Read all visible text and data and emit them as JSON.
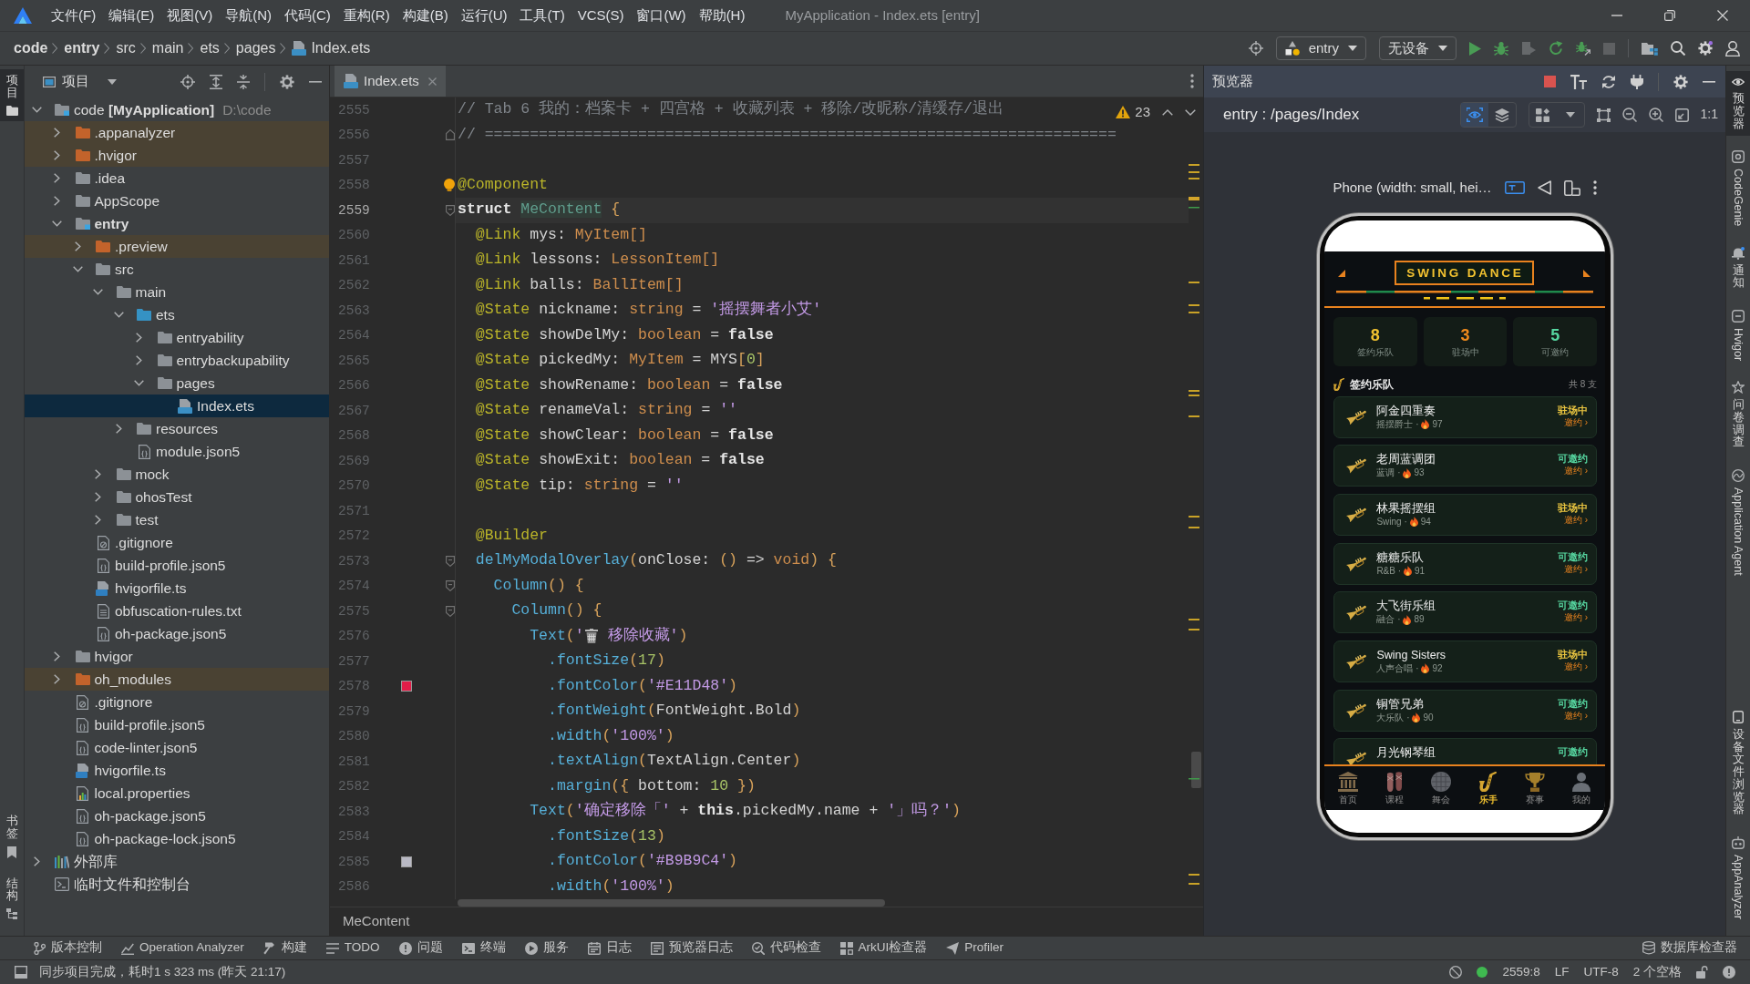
{
  "window": {
    "title": "MyApplication - Index.ets [entry]"
  },
  "menu": [
    "文件(F)",
    "编辑(E)",
    "视图(V)",
    "导航(N)",
    "代码(C)",
    "重构(R)",
    "构建(B)",
    "运行(U)",
    "工具(T)",
    "VCS(S)",
    "窗口(W)",
    "帮助(H)"
  ],
  "breadcrumb": [
    {
      "label": "code",
      "kind": "module"
    },
    {
      "label": "entry",
      "kind": "module"
    },
    {
      "label": "src",
      "kind": "folder"
    },
    {
      "label": "main",
      "kind": "folder"
    },
    {
      "label": "ets",
      "kind": "folder"
    },
    {
      "label": "pages",
      "kind": "folder"
    },
    {
      "label": "Index.ets",
      "kind": "ets-file"
    }
  ],
  "run_toolbar": {
    "module": "entry",
    "device": "无设备"
  },
  "left_strip": {
    "top": [
      {
        "label": "项目",
        "kind": "project",
        "selected": true
      }
    ],
    "bottom": [
      {
        "label": "书签",
        "kind": "bookmarks",
        "selected": false
      },
      {
        "label": "结构",
        "kind": "structure",
        "selected": false
      }
    ]
  },
  "project": {
    "title": "项目",
    "tree": [
      {
        "label": "code **[MyApplication]**",
        "path": "D:\\code",
        "kind": "project",
        "expanded": true,
        "selected": false,
        "children": [
          {
            "label": ".appanalyzer",
            "kind": "excluded",
            "expanded": false,
            "selected": false
          },
          {
            "label": ".hvigor",
            "kind": "excluded",
            "expanded": false,
            "selected": false
          },
          {
            "label": ".idea",
            "kind": "folder",
            "expanded": false,
            "selected": false
          },
          {
            "label": "AppScope",
            "kind": "folder",
            "expanded": false,
            "selected": false
          },
          {
            "label": "entry",
            "kind": "module",
            "expanded": true,
            "selected": false,
            "children": [
              {
                "label": ".preview",
                "kind": "excluded",
                "expanded": false,
                "selected": false
              },
              {
                "label": "src",
                "kind": "folder",
                "expanded": true,
                "selected": false,
                "children": [
                  {
                    "label": "main",
                    "kind": "folder",
                    "expanded": true,
                    "selected": false,
                    "children": [
                      {
                        "label": "ets",
                        "kind": "source",
                        "expanded": true,
                        "selected": false,
                        "children": [
                          {
                            "label": "entryability",
                            "kind": "folder",
                            "expanded": false,
                            "selected": false
                          },
                          {
                            "label": "entrybackupability",
                            "kind": "folder",
                            "expanded": false,
                            "selected": false
                          },
                          {
                            "label": "pages",
                            "kind": "folder",
                            "expanded": true,
                            "selected": false,
                            "children": [
                              {
                                "label": "Index.ets",
                                "kind": "ets-file",
                                "selected": true
                              }
                            ]
                          }
                        ]
                      },
                      {
                        "label": "resources",
                        "kind": "folder",
                        "expanded": false,
                        "selected": false
                      },
                      {
                        "label": "module.json5",
                        "kind": "json-file",
                        "selected": false
                      }
                    ]
                  },
                  {
                    "label": "mock",
                    "kind": "folder",
                    "expanded": false,
                    "selected": false
                  },
                  {
                    "label": "ohosTest",
                    "kind": "folder",
                    "expanded": false,
                    "selected": false
                  },
                  {
                    "label": "test",
                    "kind": "folder",
                    "expanded": false,
                    "selected": false
                  }
                ]
              },
              {
                "label": ".gitignore",
                "kind": "ignore-file",
                "selected": false
              },
              {
                "label": "build-profile.json5",
                "kind": "json-file",
                "selected": false
              },
              {
                "label": "hvigorfile.ts",
                "kind": "ts-file",
                "selected": false
              },
              {
                "label": "obfuscation-rules.txt",
                "kind": "text-file",
                "selected": false
              },
              {
                "label": "oh-package.json5",
                "kind": "json-file",
                "selected": false
              }
            ]
          },
          {
            "label": "hvigor",
            "kind": "folder",
            "expanded": false,
            "selected": false
          },
          {
            "label": "oh_modules",
            "kind": "excluded",
            "expanded": false,
            "selected": false
          },
          {
            "label": ".gitignore",
            "kind": "ignore-file",
            "selected": false
          },
          {
            "label": "build-profile.json5",
            "kind": "json-file",
            "selected": false
          },
          {
            "label": "code-linter.json5",
            "kind": "json-file",
            "selected": false
          },
          {
            "label": "hvigorfile.ts",
            "kind": "ts-file",
            "selected": false
          },
          {
            "label": "local.properties",
            "kind": "properties-file",
            "selected": false
          },
          {
            "label": "oh-package.json5",
            "kind": "json-file",
            "selected": false
          },
          {
            "label": "oh-package-lock.json5",
            "kind": "json-file",
            "selected": false
          }
        ]
      },
      {
        "label": "外部库",
        "kind": "library",
        "expanded": false,
        "selected": false
      },
      {
        "label": "临时文件和控制台",
        "kind": "scratch",
        "selected": false
      }
    ]
  },
  "editor": {
    "tabs": [
      {
        "label": "Index.ets",
        "selected": true
      }
    ],
    "warnings": "23",
    "structure_path": "MeContent",
    "lines": [
      {
        "number": "2555",
        "current": false,
        "tokens": [
          {
            "kind": "comment",
            "text": "// Tab 6 我的：档案卡 + 四宫格 + 收藏列表 + 移除/改昵称/清缓存/退出"
          }
        ]
      },
      {
        "number": "2556",
        "current": false,
        "fold_end": true,
        "tokens": [
          {
            "kind": "comment",
            "text": "// ======================================================================"
          }
        ]
      },
      {
        "number": "2557",
        "current": false
      },
      {
        "number": "2558",
        "current": false,
        "bulb": true,
        "tokens": [
          {
            "kind": "decorator",
            "text": "@Component"
          }
        ]
      },
      {
        "number": "2559",
        "current": true,
        "fold_start": true,
        "tokens": [
          {
            "kind": "keyword",
            "text": "struct "
          },
          {
            "kind": "unused",
            "text": "MeContent"
          },
          {
            "kind": "punct",
            "text": " {"
          }
        ]
      },
      {
        "number": "2560",
        "current": false,
        "tokens": [
          {
            "kind": "decorator",
            "text": "  @Link"
          },
          {
            "kind": "plain",
            "text": " mys: "
          },
          {
            "kind": "type",
            "text": "MyItem[]"
          }
        ]
      },
      {
        "number": "2561",
        "current": false,
        "tokens": [
          {
            "kind": "decorator",
            "text": "  @Link"
          },
          {
            "kind": "plain",
            "text": " lessons: "
          },
          {
            "kind": "type",
            "text": "LessonItem[]"
          }
        ]
      },
      {
        "number": "2562",
        "current": false,
        "tokens": [
          {
            "kind": "decorator",
            "text": "  @Link"
          },
          {
            "kind": "plain",
            "text": " balls: "
          },
          {
            "kind": "type",
            "text": "BallItem[]"
          }
        ]
      },
      {
        "number": "2563",
        "current": false,
        "tokens": [
          {
            "kind": "decorator",
            "text": "  @State"
          },
          {
            "kind": "plain",
            "text": " nickname: "
          },
          {
            "kind": "type",
            "text": "string"
          },
          {
            "kind": "plain",
            "text": " = "
          },
          {
            "kind": "string",
            "text": "'摇摆舞者小艾'"
          }
        ]
      },
      {
        "number": "2564",
        "current": false,
        "tokens": [
          {
            "kind": "decorator",
            "text": "  @State"
          },
          {
            "kind": "plain",
            "text": " showDelMy: "
          },
          {
            "kind": "type",
            "text": "boolean"
          },
          {
            "kind": "plain",
            "text": " = "
          },
          {
            "kind": "keyword",
            "text": "false"
          }
        ]
      },
      {
        "number": "2565",
        "current": false,
        "tokens": [
          {
            "kind": "decorator",
            "text": "  @State"
          },
          {
            "kind": "plain",
            "text": " pickedMy: "
          },
          {
            "kind": "type",
            "text": "MyItem"
          },
          {
            "kind": "plain",
            "text": " = MYS"
          },
          {
            "kind": "punct",
            "text": "["
          },
          {
            "kind": "number",
            "text": "0"
          },
          {
            "kind": "punct",
            "text": "]"
          }
        ]
      },
      {
        "number": "2566",
        "current": false,
        "tokens": [
          {
            "kind": "decorator",
            "text": "  @State"
          },
          {
            "kind": "plain",
            "text": " showRename: "
          },
          {
            "kind": "type",
            "text": "boolean"
          },
          {
            "kind": "plain",
            "text": " = "
          },
          {
            "kind": "keyword",
            "text": "false"
          }
        ]
      },
      {
        "number": "2567",
        "current": false,
        "tokens": [
          {
            "kind": "decorator",
            "text": "  @State"
          },
          {
            "kind": "plain",
            "text": " renameVal: "
          },
          {
            "kind": "type",
            "text": "string"
          },
          {
            "kind": "plain",
            "text": " = "
          },
          {
            "kind": "string",
            "text": "''"
          }
        ]
      },
      {
        "number": "2568",
        "current": false,
        "tokens": [
          {
            "kind": "decorator",
            "text": "  @State"
          },
          {
            "kind": "plain",
            "text": " showClear: "
          },
          {
            "kind": "type",
            "text": "boolean"
          },
          {
            "kind": "plain",
            "text": " = "
          },
          {
            "kind": "keyword",
            "text": "false"
          }
        ]
      },
      {
        "number": "2569",
        "current": false,
        "tokens": [
          {
            "kind": "decorator",
            "text": "  @State"
          },
          {
            "kind": "plain",
            "text": " showExit: "
          },
          {
            "kind": "type",
            "text": "boolean"
          },
          {
            "kind": "plain",
            "text": " = "
          },
          {
            "kind": "keyword",
            "text": "false"
          }
        ]
      },
      {
        "number": "2570",
        "current": false,
        "tokens": [
          {
            "kind": "decorator",
            "text": "  @State"
          },
          {
            "kind": "plain",
            "text": " tip: "
          },
          {
            "kind": "type",
            "text": "string"
          },
          {
            "kind": "plain",
            "text": " = "
          },
          {
            "kind": "string",
            "text": "''"
          }
        ]
      },
      {
        "number": "2571",
        "current": false
      },
      {
        "number": "2572",
        "current": false,
        "tokens": [
          {
            "kind": "decorator",
            "text": "  @Builder"
          }
        ]
      },
      {
        "number": "2573",
        "current": false,
        "fold_start": true,
        "tokens": [
          {
            "kind": "call",
            "text": "  delMyModalOverlay"
          },
          {
            "kind": "punct",
            "text": "("
          },
          {
            "kind": "plain",
            "text": "onClose: "
          },
          {
            "kind": "punct",
            "text": "()"
          },
          {
            "kind": "plain",
            "text": " => "
          },
          {
            "kind": "type",
            "text": "void"
          },
          {
            "kind": "punct",
            "text": ") {"
          }
        ]
      },
      {
        "number": "2574",
        "current": false,
        "fold_start": true,
        "tokens": [
          {
            "kind": "call",
            "text": "    Column"
          },
          {
            "kind": "punct",
            "text": "() {"
          }
        ]
      },
      {
        "number": "2575",
        "current": false,
        "fold_start": true,
        "tokens": [
          {
            "kind": "call",
            "text": "      Column"
          },
          {
            "kind": "punct",
            "text": "() {"
          }
        ]
      },
      {
        "number": "2576",
        "current": false,
        "tokens": [
          {
            "kind": "call",
            "text": "        Text"
          },
          {
            "kind": "punct",
            "text": "("
          },
          {
            "kind": "string",
            "text": "'"
          },
          {
            "kind": "emoji"
          },
          {
            "kind": "string",
            "text": " 移除收藏'"
          },
          {
            "kind": "punct",
            "text": ")"
          }
        ]
      },
      {
        "number": "2577",
        "current": false,
        "tokens": [
          {
            "kind": "call",
            "text": "          .fontSize"
          },
          {
            "kind": "punct",
            "text": "("
          },
          {
            "kind": "number",
            "text": "17"
          },
          {
            "kind": "punct",
            "text": ")"
          }
        ]
      },
      {
        "number": "2578",
        "current": false,
        "color": "#E11D48",
        "tokens": [
          {
            "kind": "call",
            "text": "          .fontColor"
          },
          {
            "kind": "punct",
            "text": "("
          },
          {
            "kind": "string",
            "text": "'#E11D48'"
          },
          {
            "kind": "punct",
            "text": ")"
          }
        ]
      },
      {
        "number": "2579",
        "current": false,
        "tokens": [
          {
            "kind": "call",
            "text": "          .fontWeight"
          },
          {
            "kind": "punct",
            "text": "("
          },
          {
            "kind": "plain",
            "text": "FontWeight.Bold"
          },
          {
            "kind": "punct",
            "text": ")"
          }
        ]
      },
      {
        "number": "2580",
        "current": false,
        "tokens": [
          {
            "kind": "call",
            "text": "          .width"
          },
          {
            "kind": "punct",
            "text": "("
          },
          {
            "kind": "string",
            "text": "'100%'"
          },
          {
            "kind": "punct",
            "text": ")"
          }
        ]
      },
      {
        "number": "2581",
        "current": false,
        "tokens": [
          {
            "kind": "call",
            "text": "          .textAlign"
          },
          {
            "kind": "punct",
            "text": "("
          },
          {
            "kind": "plain",
            "text": "TextAlign.Center"
          },
          {
            "kind": "punct",
            "text": ")"
          }
        ]
      },
      {
        "number": "2582",
        "current": false,
        "tokens": [
          {
            "kind": "call",
            "text": "          .margin"
          },
          {
            "kind": "punct",
            "text": "({"
          },
          {
            "kind": "plain",
            "text": " bottom: "
          },
          {
            "kind": "number",
            "text": "10"
          },
          {
            "kind": "punct",
            "text": " })"
          }
        ]
      },
      {
        "number": "2583",
        "current": false,
        "tokens": [
          {
            "kind": "call",
            "text": "        Text"
          },
          {
            "kind": "punct",
            "text": "("
          },
          {
            "kind": "string",
            "text": "'确定移除「'"
          },
          {
            "kind": "plain",
            "text": " + "
          },
          {
            "kind": "keyword",
            "text": "this"
          },
          {
            "kind": "plain",
            "text": ".pickedMy.name + "
          },
          {
            "kind": "string",
            "text": "'」吗？'"
          },
          {
            "kind": "punct",
            "text": ")"
          }
        ]
      },
      {
        "number": "2584",
        "current": false,
        "tokens": [
          {
            "kind": "call",
            "text": "          .fontSize"
          },
          {
            "kind": "punct",
            "text": "("
          },
          {
            "kind": "number",
            "text": "13"
          },
          {
            "kind": "punct",
            "text": ")"
          }
        ]
      },
      {
        "number": "2585",
        "current": false,
        "color": "#B9B9C4",
        "tokens": [
          {
            "kind": "call",
            "text": "          .fontColor"
          },
          {
            "kind": "punct",
            "text": "("
          },
          {
            "kind": "string",
            "text": "'#B9B9C4'"
          },
          {
            "kind": "punct",
            "text": ")"
          }
        ]
      },
      {
        "number": "2586",
        "current": false,
        "tokens": [
          {
            "kind": "call",
            "text": "          .width"
          },
          {
            "kind": "punct",
            "text": "("
          },
          {
            "kind": "string",
            "text": "'100%'"
          },
          {
            "kind": "punct",
            "text": ")"
          }
        ]
      }
    ]
  },
  "preview": {
    "title": "预览器",
    "route": "entry : /pages/Index",
    "inspector": {
      "on": true
    },
    "actual_size": "1:1",
    "device": "Phone (width: small, hei…",
    "app": {
      "banner": "SWING DANCE",
      "stats": [
        {
          "value": "8",
          "label": "签约乐队",
          "color": "#f2c230"
        },
        {
          "value": "3",
          "label": "驻场中",
          "color": "#f08a1c"
        },
        {
          "value": "5",
          "label": "可邀约",
          "color": "#56d6a0"
        }
      ],
      "section": {
        "title": "签约乐队",
        "count": "共 8 支"
      },
      "bands": [
        {
          "name": "阿金四重奏",
          "genre": "摇摆爵士 ·",
          "heat": "97",
          "status": {
            "text": "驻场中",
            "color": "#e9c440"
          },
          "action": "邀约 ›"
        },
        {
          "name": "老周蓝调团",
          "genre": "蓝调 ·",
          "heat": "93",
          "status": {
            "text": "可邀约",
            "color": "#56d6a0"
          },
          "action": "邀约 ›"
        },
        {
          "name": "林果摇摆组",
          "genre": "Swing ·",
          "heat": "94",
          "status": {
            "text": "驻场中",
            "color": "#e9c440"
          },
          "action": "邀约 ›"
        },
        {
          "name": "糖糖乐队",
          "genre": "R&B ·",
          "heat": "91",
          "status": {
            "text": "可邀约",
            "color": "#56d6a0"
          },
          "action": "邀约 ›"
        },
        {
          "name": "大飞街乐组",
          "genre": "融合 ·",
          "heat": "89",
          "status": {
            "text": "可邀约",
            "color": "#56d6a0"
          },
          "action": "邀约 ›"
        },
        {
          "name": "Swing Sisters",
          "genre": "人声合唱 ·",
          "heat": "92",
          "status": {
            "text": "驻场中",
            "color": "#e9c440"
          },
          "action": "邀约 ›"
        },
        {
          "name": "铜管兄弟",
          "genre": "大乐队 ·",
          "heat": "90",
          "status": {
            "text": "可邀约",
            "color": "#56d6a0"
          },
          "action": "邀约 ›"
        },
        {
          "name": "月光钢琴组",
          "status": {
            "text": "可邀约",
            "color": "#56d6a0"
          }
        }
      ],
      "nav": [
        {
          "label": "首页",
          "kind": "home",
          "selected": false
        },
        {
          "label": "课程",
          "kind": "course",
          "selected": false
        },
        {
          "label": "舞会",
          "kind": "ball",
          "selected": false
        },
        {
          "label": "乐手",
          "kind": "musician",
          "selected": true
        },
        {
          "label": "赛事",
          "kind": "contest",
          "selected": false
        },
        {
          "label": "我的",
          "kind": "profile",
          "selected": false
        }
      ]
    }
  },
  "right_strip": {
    "top": [
      {
        "label": "预览器",
        "kind": "preview",
        "selected": true
      },
      {
        "label": "CodeGenie",
        "kind": "codegenie",
        "selected": false
      },
      {
        "label": "通知",
        "kind": "notifications",
        "selected": false
      },
      {
        "label": "Hvigor",
        "kind": "hvigor",
        "selected": false
      },
      {
        "label": "问卷调查",
        "kind": "survey",
        "selected": false
      },
      {
        "label": "Application Agent",
        "kind": "agent",
        "selected": false
      }
    ],
    "bottom": [
      {
        "label": "设备文件浏览器",
        "kind": "device-files",
        "selected": false
      },
      {
        "label": "AppAnalyzer",
        "kind": "analyzer",
        "selected": false
      }
    ]
  },
  "tool_windows": {
    "left": [
      {
        "label": "版本控制",
        "kind": "vcs"
      },
      {
        "label": "Operation Analyzer",
        "kind": "analyzer"
      },
      {
        "label": "构建",
        "kind": "build"
      },
      {
        "label": "TODO",
        "kind": "todo"
      },
      {
        "label": "问题",
        "kind": "problems"
      },
      {
        "label": "终端",
        "kind": "terminal"
      },
      {
        "label": "服务",
        "kind": "services"
      },
      {
        "label": "日志",
        "kind": "log"
      },
      {
        "label": "预览器日志",
        "kind": "preview-log"
      },
      {
        "label": "代码检查",
        "kind": "inspection"
      },
      {
        "label": "ArkUI检查器",
        "kind": "arkui"
      },
      {
        "label": "Profiler",
        "kind": "profiler"
      }
    ],
    "right": [
      {
        "label": "数据库检查器",
        "kind": "database"
      }
    ]
  },
  "status_bar": {
    "message": "同步项目完成，耗时1 s 323 ms (昨天 21:17)",
    "caret": "2559:8",
    "line_separator": "LF",
    "encoding": "UTF-8",
    "indent": "2 个空格"
  }
}
